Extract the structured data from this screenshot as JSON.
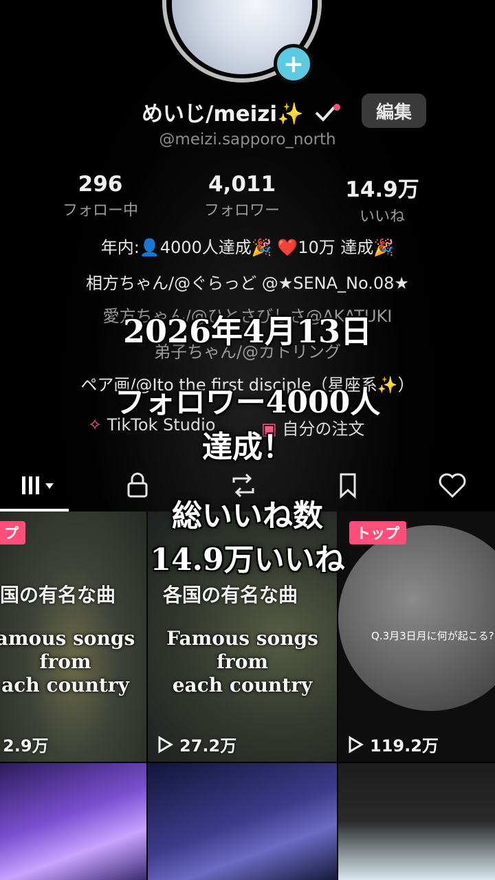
{
  "profile": {
    "display_name": "めいじ/meizi✨",
    "username": "@meizi.sapporo_north",
    "edit_label": "編集",
    "add_icon": "plus-icon"
  },
  "stats": [
    {
      "value": "296",
      "label": "フォロー中"
    },
    {
      "value": "4,011",
      "label": "フォロワー"
    },
    {
      "value": "14.9万",
      "label": "いいね"
    }
  ],
  "bio": {
    "line1": "年内:👤4000人達成🎉 ❤️10万 達成🎉",
    "line2": "相方ちゃん/@ぐらっど @★SENA_No.08★",
    "line3": "愛方ちゃん/@ひとさびしさ@AKATUKI",
    "line4": "弟子ちゃん/@カトリング",
    "line5": "ペア画/@Ito the first disciple（星座系✨）"
  },
  "links": {
    "studio": "TikTok Studio",
    "orders": "自分の注文"
  },
  "tabs": [
    "videos-grid",
    "private",
    "reposts",
    "saved",
    "liked"
  ],
  "videos": [
    {
      "badge": "プ",
      "title": "国の有名な曲",
      "subtitle": "amous songs\nfrom\nach country",
      "views": "2.9万"
    },
    {
      "badge": "",
      "title": "各国の有名な曲",
      "subtitle": "Famous songs\nfrom\neach country",
      "views": "27.2万"
    },
    {
      "badge": "トップ",
      "title": "",
      "subtitle": "Q.3月3日月に何が起こる?",
      "views": "119.2万"
    }
  ],
  "overlay": {
    "date": "2026年4月13日",
    "line_a": "フォロワー4000人",
    "line_b": "達成！",
    "line_c": "総いいね数",
    "line_d": "14.9万いいね"
  },
  "colors": {
    "accent_pink": "#ff4e7a",
    "plus_cyan": "#5cc9e0",
    "background": "#000000"
  }
}
